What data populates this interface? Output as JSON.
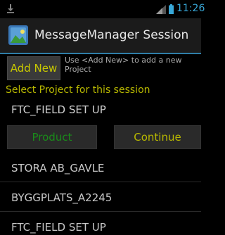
{
  "status_bar": {
    "time": "11:26",
    "icons": [
      "download-icon",
      "signal-icon",
      "battery-icon"
    ]
  },
  "action_bar": {
    "title": "MessageManager Session",
    "icon": "app-icon"
  },
  "add_new": {
    "button_label": "Add New",
    "hint": "Use <Add New> to add a new Project"
  },
  "select_label": "Select Project for this session",
  "selected_project": "FTC_FIELD SET UP",
  "buttons": {
    "product": "Product",
    "continue": "Continue"
  },
  "projects": [
    "STORA AB_GAVLE",
    "BYGGPLATS_A2245",
    "FTC_FIELD SET UP"
  ],
  "colors": {
    "accent_blue": "#38a8d8",
    "yellow": "#c8c800",
    "green": "#1a8a1a",
    "background": "#000000"
  }
}
